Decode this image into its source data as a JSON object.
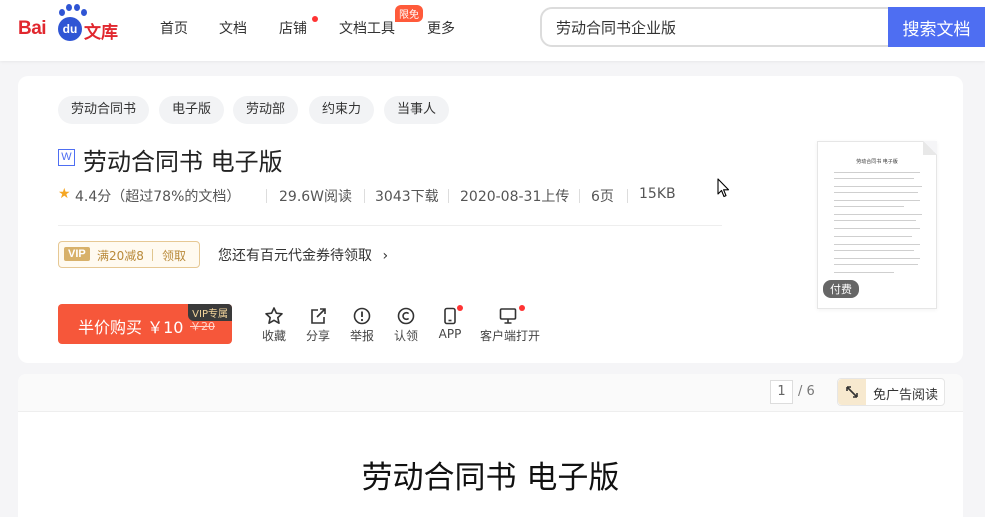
{
  "header": {
    "logo": {
      "bai": "Bai",
      "du": "du",
      "wenku": "文库"
    },
    "nav": [
      {
        "label": "首页"
      },
      {
        "label": "文档"
      },
      {
        "label": "店铺"
      },
      {
        "label": "文档工具",
        "badge": "限免"
      },
      {
        "label": "更多"
      }
    ],
    "search": {
      "value": "劳动合同书企业版",
      "button": "搜索文档"
    }
  },
  "doc": {
    "tags": [
      "劳动合同书",
      "电子版",
      "劳动部",
      "约束力",
      "当事人"
    ],
    "type_icon": "W",
    "title": "劳动合同书 电子版",
    "rating": "4.4分（超过78%的文档）",
    "reads": "29.6W阅读",
    "downloads": "3043下载",
    "upload_date": "2020-08-31上传",
    "pages": "6页",
    "size": "15KB",
    "coupon": {
      "vip": "VIP",
      "text": "满20减8",
      "get": "领取"
    },
    "coupon_tip": "您还有百元代金券待领取",
    "buy": {
      "label": "半价购买 ￥10",
      "old_price": "￥20",
      "vip_tag": "VIP专属"
    },
    "actions": [
      {
        "label": "收藏",
        "icon": "star-icon"
      },
      {
        "label": "分享",
        "icon": "share-icon"
      },
      {
        "label": "举报",
        "icon": "report-icon"
      },
      {
        "label": "认领",
        "icon": "copyright-icon"
      },
      {
        "label": "APP",
        "icon": "phone-icon"
      },
      {
        "label": "客户端打开",
        "icon": "monitor-icon"
      }
    ],
    "thumb": {
      "title": "劳动合同书 电子版",
      "paid": "付费"
    }
  },
  "reader": {
    "current_page": "1",
    "total_pages": "/ 6",
    "adfree": "免广告阅读",
    "page_title": "劳动合同书  电子版"
  },
  "colors": {
    "accent": "#4e6ef2",
    "buy": "#f6573a",
    "brand_red": "#e1272e"
  }
}
